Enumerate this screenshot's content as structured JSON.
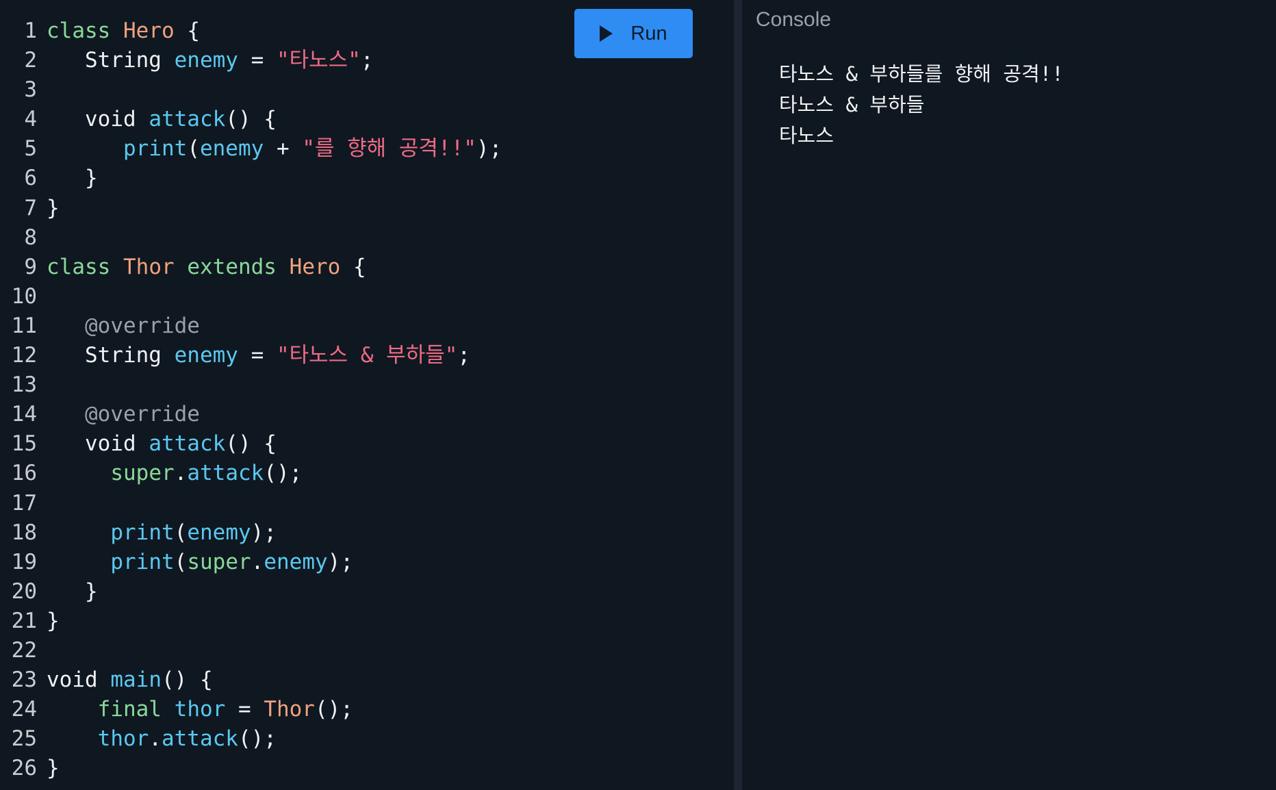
{
  "run_button": {
    "label": "Run",
    "icon": "play-icon"
  },
  "console": {
    "title": "Console",
    "output": [
      "타노스 & 부하들를 향해 공격!!",
      "타노스 & 부하들",
      "타노스"
    ]
  },
  "colors": {
    "background": "#0f1720",
    "keyword": "#8ad99a",
    "class_name": "#f2a27e",
    "identifier": "#5ac8f0",
    "string": "#f06b86",
    "annotation": "#9aa1a8",
    "run_button": "#2f8cf2"
  },
  "code_lines": [
    {
      "n": "1",
      "tokens": [
        [
          "kw",
          "class"
        ],
        [
          "plain",
          " "
        ],
        [
          "cls",
          "Hero"
        ],
        [
          "plain",
          " {"
        ]
      ]
    },
    {
      "n": "2",
      "tokens": [
        [
          "plain",
          "   String "
        ],
        [
          "fn",
          "enemy"
        ],
        [
          "plain",
          " = "
        ],
        [
          "str",
          "\"타노스\""
        ],
        [
          "plain",
          ";"
        ]
      ]
    },
    {
      "n": "3",
      "tokens": []
    },
    {
      "n": "4",
      "tokens": [
        [
          "plain",
          "   void "
        ],
        [
          "fn",
          "attack"
        ],
        [
          "plain",
          "() {"
        ]
      ]
    },
    {
      "n": "5",
      "tokens": [
        [
          "plain",
          "      "
        ],
        [
          "fn",
          "print"
        ],
        [
          "plain",
          "("
        ],
        [
          "fn",
          "enemy"
        ],
        [
          "plain",
          " + "
        ],
        [
          "str",
          "\"를 향해 공격!!\""
        ],
        [
          "plain",
          ");"
        ]
      ]
    },
    {
      "n": "6",
      "tokens": [
        [
          "plain",
          "   }"
        ]
      ]
    },
    {
      "n": "7",
      "tokens": [
        [
          "plain",
          "}"
        ]
      ]
    },
    {
      "n": "8",
      "tokens": []
    },
    {
      "n": "9",
      "tokens": [
        [
          "kw",
          "class"
        ],
        [
          "plain",
          " "
        ],
        [
          "cls",
          "Thor"
        ],
        [
          "plain",
          " "
        ],
        [
          "kw",
          "extends"
        ],
        [
          "plain",
          " "
        ],
        [
          "cls",
          "Hero"
        ],
        [
          "plain",
          " {"
        ]
      ]
    },
    {
      "n": "10",
      "tokens": []
    },
    {
      "n": "11",
      "tokens": [
        [
          "plain",
          "   "
        ],
        [
          "ann",
          "@override"
        ]
      ]
    },
    {
      "n": "12",
      "tokens": [
        [
          "plain",
          "   String "
        ],
        [
          "fn",
          "enemy"
        ],
        [
          "plain",
          " = "
        ],
        [
          "str",
          "\"타노스 & 부하들\""
        ],
        [
          "plain",
          ";"
        ]
      ]
    },
    {
      "n": "13",
      "tokens": []
    },
    {
      "n": "14",
      "tokens": [
        [
          "plain",
          "   "
        ],
        [
          "ann",
          "@override"
        ]
      ]
    },
    {
      "n": "15",
      "tokens": [
        [
          "plain",
          "   void "
        ],
        [
          "fn",
          "attack"
        ],
        [
          "plain",
          "() {"
        ]
      ]
    },
    {
      "n": "16",
      "tokens": [
        [
          "plain",
          "     "
        ],
        [
          "kw",
          "super"
        ],
        [
          "plain",
          "."
        ],
        [
          "fn",
          "attack"
        ],
        [
          "plain",
          "();"
        ]
      ]
    },
    {
      "n": "17",
      "tokens": []
    },
    {
      "n": "18",
      "tokens": [
        [
          "plain",
          "     "
        ],
        [
          "fn",
          "print"
        ],
        [
          "plain",
          "("
        ],
        [
          "fn",
          "enemy"
        ],
        [
          "plain",
          ");"
        ]
      ]
    },
    {
      "n": "19",
      "tokens": [
        [
          "plain",
          "     "
        ],
        [
          "fn",
          "print"
        ],
        [
          "plain",
          "("
        ],
        [
          "kw",
          "super"
        ],
        [
          "plain",
          "."
        ],
        [
          "fn",
          "enemy"
        ],
        [
          "plain",
          ");"
        ]
      ]
    },
    {
      "n": "20",
      "tokens": [
        [
          "plain",
          "   }"
        ]
      ]
    },
    {
      "n": "21",
      "tokens": [
        [
          "plain",
          "}"
        ]
      ]
    },
    {
      "n": "22",
      "tokens": []
    },
    {
      "n": "23",
      "tokens": [
        [
          "plain",
          "void "
        ],
        [
          "fn",
          "main"
        ],
        [
          "plain",
          "() {"
        ]
      ]
    },
    {
      "n": "24",
      "tokens": [
        [
          "plain",
          "    "
        ],
        [
          "kw",
          "final"
        ],
        [
          "plain",
          " "
        ],
        [
          "fn",
          "thor"
        ],
        [
          "plain",
          " = "
        ],
        [
          "cls",
          "Thor"
        ],
        [
          "plain",
          "();"
        ]
      ]
    },
    {
      "n": "25",
      "tokens": [
        [
          "plain",
          "    "
        ],
        [
          "fn",
          "thor"
        ],
        [
          "plain",
          "."
        ],
        [
          "fn",
          "attack"
        ],
        [
          "plain",
          "();"
        ]
      ]
    },
    {
      "n": "26",
      "tokens": [
        [
          "plain",
          "}"
        ]
      ]
    }
  ]
}
